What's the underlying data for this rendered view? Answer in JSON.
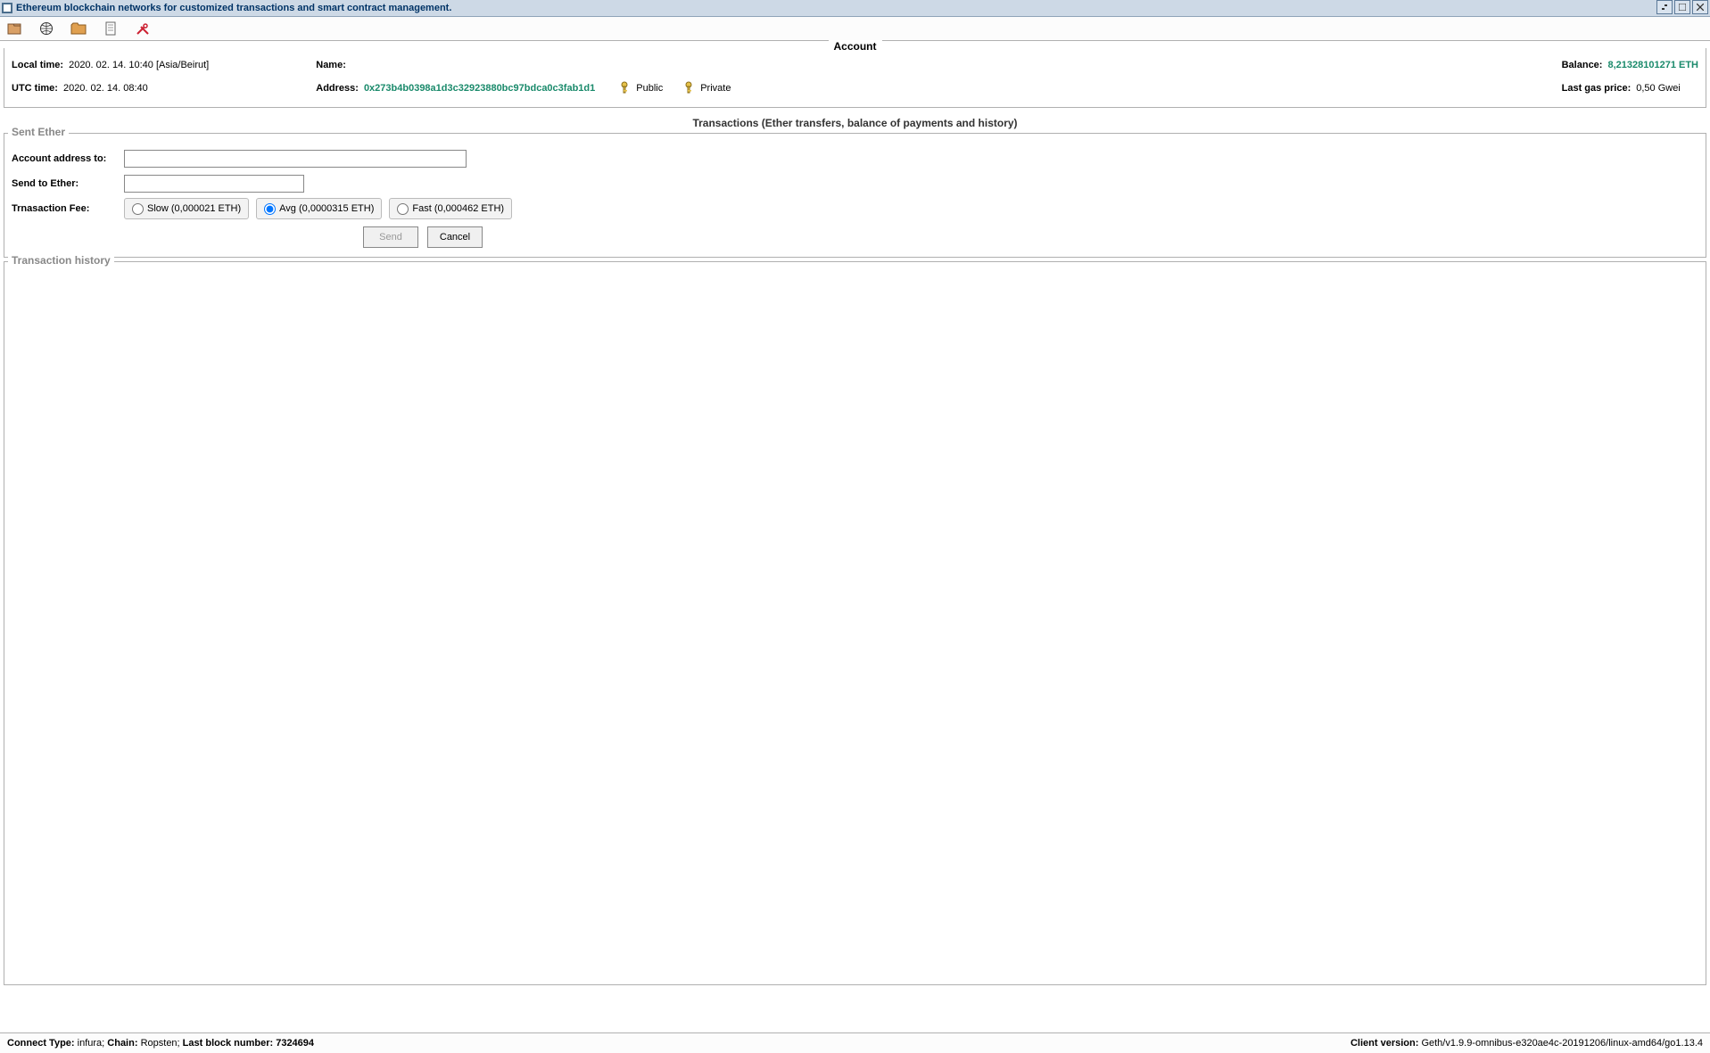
{
  "window": {
    "title": "Ethereum blockchain networks for customized transactions and smart contract management."
  },
  "account": {
    "legend": "Account",
    "local_time_label": "Local time:",
    "local_time_value": "2020. 02. 14. 10:40 [Asia/Beirut]",
    "utc_time_label": "UTC time:",
    "utc_time_value": "2020. 02. 14. 08:40",
    "name_label": "Name:",
    "name_value": "",
    "address_label": "Address:",
    "address_value": "0x273b4b0398a1d3c32923880bc97bdca0c3fab1d1",
    "public_label": "Public",
    "private_label": "Private",
    "balance_label": "Balance:",
    "balance_value": "8,21328101271 ETH",
    "gas_label": "Last gas price:",
    "gas_value": "0,50 Gwei"
  },
  "transactions": {
    "title": "Transactions (Ether transfers, balance of payments and history)",
    "sent_legend": "Sent Ether",
    "addr_to_label": "Account address to:",
    "addr_to_value": "",
    "send_eth_label": "Send to Ether:",
    "send_eth_value": "",
    "fee_label": "Trnasaction Fee:",
    "fee_options": {
      "slow": "Slow (0,000021 ETH)",
      "avg": "Avg (0,0000315 ETH)",
      "fast": "Fast (0,000462 ETH)"
    },
    "send_btn": "Send",
    "cancel_btn": "Cancel",
    "history_legend": "Transaction history"
  },
  "status": {
    "left_labels": {
      "connect": "Connect Type:",
      "chain": "Chain:",
      "block": "Last block number:"
    },
    "left_values": {
      "connect": "infura;",
      "chain": "Ropsten;",
      "block": "7324694"
    },
    "right_label": "Client version:",
    "right_value": "Geth/v1.9.9-omnibus-e320ae4c-20191206/linux-amd64/go1.13.4"
  }
}
